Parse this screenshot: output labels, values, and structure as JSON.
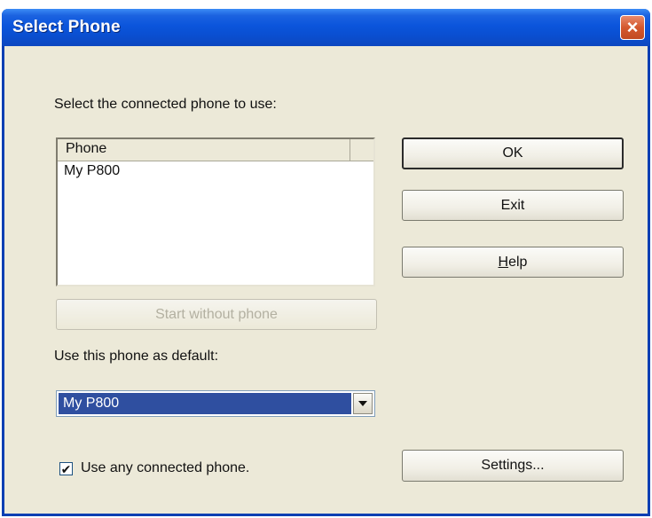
{
  "window": {
    "title": "Select Phone",
    "close_glyph": "×"
  },
  "main": {
    "select_label": "Select the connected phone to use:",
    "list": {
      "column_header": "Phone",
      "rows": [
        "My P800"
      ]
    },
    "start_without_phone_label": "Start without phone",
    "default_label": "Use this phone as default:",
    "default_combo": {
      "selected_value": "My P800"
    },
    "use_any_checkbox": {
      "label": "Use any connected phone.",
      "checked": true,
      "check_glyph": "✔"
    }
  },
  "buttons": {
    "ok_label": "OK",
    "exit_label": "Exit",
    "help_mnemonic": "H",
    "help_rest": "elp",
    "settings_label": "Settings..."
  },
  "colors": {
    "titlebar": "#0a4fd1",
    "dialog_bg": "#ece9d8",
    "selection": "#2f4fa0",
    "close_button": "#d4582f"
  },
  "icons": {
    "close": "close-icon",
    "dropdown": "chevron-down-icon",
    "check": "checkmark-icon"
  }
}
